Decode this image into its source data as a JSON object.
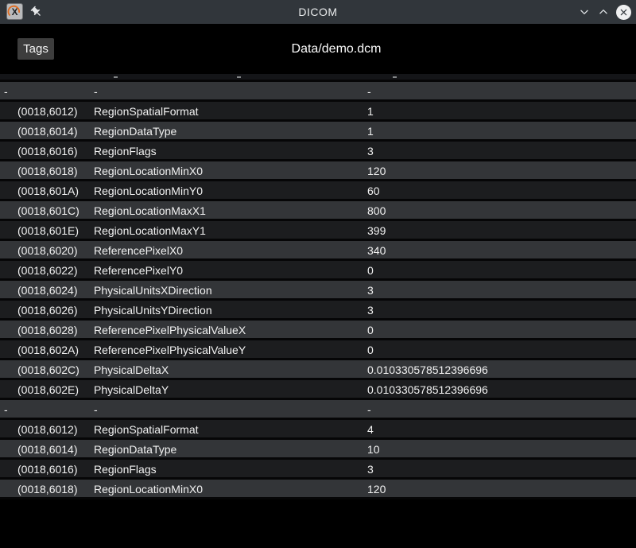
{
  "window": {
    "title": "DICOM",
    "icons": {
      "app": "x-application-icon",
      "pin": "pushpin-icon",
      "minimize": "chevron-down-icon",
      "maximize": "chevron-up-icon",
      "close": "close-x-icon"
    }
  },
  "header": {
    "tags_button_label": "Tags",
    "file_path": "Data/demo.dcm"
  },
  "table": {
    "columns": [
      "tag",
      "name",
      "value"
    ],
    "rows": [
      {
        "tag": "-",
        "name": "-",
        "value": "-",
        "group": true
      },
      {
        "tag": "(0018,6012)",
        "name": "RegionSpatialFormat",
        "value": "1"
      },
      {
        "tag": "(0018,6014)",
        "name": "RegionDataType",
        "value": "1"
      },
      {
        "tag": "(0018,6016)",
        "name": "RegionFlags",
        "value": "3"
      },
      {
        "tag": "(0018,6018)",
        "name": "RegionLocationMinX0",
        "value": "120"
      },
      {
        "tag": "(0018,601A)",
        "name": "RegionLocationMinY0",
        "value": "60"
      },
      {
        "tag": "(0018,601C)",
        "name": "RegionLocationMaxX1",
        "value": "800"
      },
      {
        "tag": "(0018,601E)",
        "name": "RegionLocationMaxY1",
        "value": "399"
      },
      {
        "tag": "(0018,6020)",
        "name": "ReferencePixelX0",
        "value": "340"
      },
      {
        "tag": "(0018,6022)",
        "name": "ReferencePixelY0",
        "value": "0"
      },
      {
        "tag": "(0018,6024)",
        "name": "PhysicalUnitsXDirection",
        "value": "3"
      },
      {
        "tag": "(0018,6026)",
        "name": "PhysicalUnitsYDirection",
        "value": "3"
      },
      {
        "tag": "(0018,6028)",
        "name": "ReferencePixelPhysicalValueX",
        "value": "0"
      },
      {
        "tag": "(0018,602A)",
        "name": "ReferencePixelPhysicalValueY",
        "value": "0"
      },
      {
        "tag": "(0018,602C)",
        "name": "PhysicalDeltaX",
        "value": "0.010330578512396696"
      },
      {
        "tag": "(0018,602E)",
        "name": "PhysicalDeltaY",
        "value": "0.010330578512396696"
      },
      {
        "tag": "-",
        "name": "-",
        "value": "-",
        "group": true
      },
      {
        "tag": "(0018,6012)",
        "name": "RegionSpatialFormat",
        "value": "4"
      },
      {
        "tag": "(0018,6014)",
        "name": "RegionDataType",
        "value": "10"
      },
      {
        "tag": "(0018,6016)",
        "name": "RegionFlags",
        "value": "3"
      },
      {
        "tag": "(0018,6018)",
        "name": "RegionLocationMinX0",
        "value": "120"
      }
    ]
  },
  "colors": {
    "titlebar": "#31363b",
    "header_bg": "#000000",
    "row_light": "#333538",
    "row_dark": "#1c1d1f",
    "row_separator": "#060607",
    "text": "#f2f2f2",
    "tags_button_bg": "#3d3d3d",
    "close_button_bg": "#eff0f1",
    "control_icon": "#dce0e3",
    "app_icon_orange": "#e06b1f"
  }
}
